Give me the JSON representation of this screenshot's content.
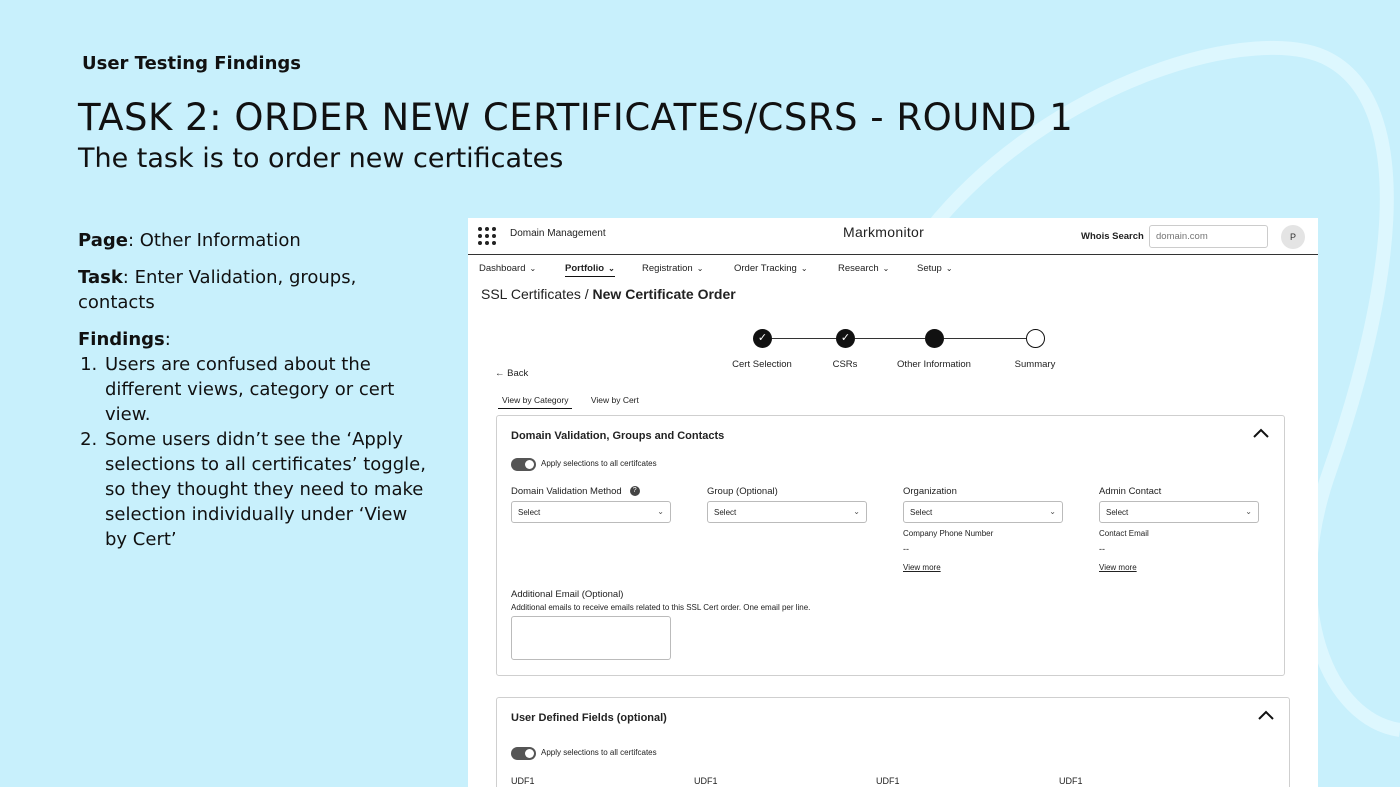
{
  "slide": {
    "eyebrow": "User Testing Findings",
    "title": "TASK 2: ORDER NEW CERTIFICATES/CSRS - ROUND 1",
    "subtitle": "The task is to order new certificates",
    "page_label": "Page",
    "page_value": ": Other Information",
    "task_label": "Task",
    "task_value": ": Enter Validation, groups, contacts",
    "findings_label": "Findings",
    "findings_colon": ":",
    "findings": [
      "Users are confused about the different views, category or cert view.",
      "Some users didn’t see the ‘Apply selections to all certificates’ toggle, so they thought they need to make selection individually under ‘View by Cert’"
    ]
  },
  "app": {
    "app_name": "Domain Management",
    "brand": "Markmonitor",
    "whois_label": "Whois Search",
    "whois_placeholder": "domain.com",
    "avatar_initial": "P",
    "nav": [
      "Dashboard",
      "Portfolio",
      "Registration",
      "Order Tracking",
      "Research",
      "Setup"
    ],
    "active_nav": "Portfolio",
    "breadcrumb_parent": "SSL Certificates",
    "breadcrumb_sep": "/",
    "breadcrumb_current": "New Certificate Order",
    "steps": [
      "Cert Selection",
      "CSRs",
      "Other Information",
      "Summary"
    ],
    "back_label": "Back",
    "view_tabs": [
      "View by Category",
      "View by Cert"
    ],
    "section1": {
      "title": "Domain Validation, Groups and Contacts",
      "toggle_label": "Apply selections to all certifcates",
      "fields": [
        "Domain Validation Method",
        "Group (Optional)",
        "Organization",
        "Admin Contact"
      ],
      "select_placeholder": "Select",
      "org_sub_label": "Company Phone Number",
      "org_sub_value": "--",
      "admin_sub_label": "Contact Email",
      "admin_sub_value": "--",
      "view_more": "View more",
      "additional_email_label": "Additional Email (Optional)",
      "additional_email_help": "Additional emails to receive emails related to this SSL Cert order. One email per line."
    },
    "section2": {
      "title": "User Defined Fields (optional)",
      "toggle_label": "Apply selections to all certifcates",
      "udf_labels": [
        "UDF1",
        "UDF1",
        "UDF1",
        "UDF1"
      ]
    }
  }
}
